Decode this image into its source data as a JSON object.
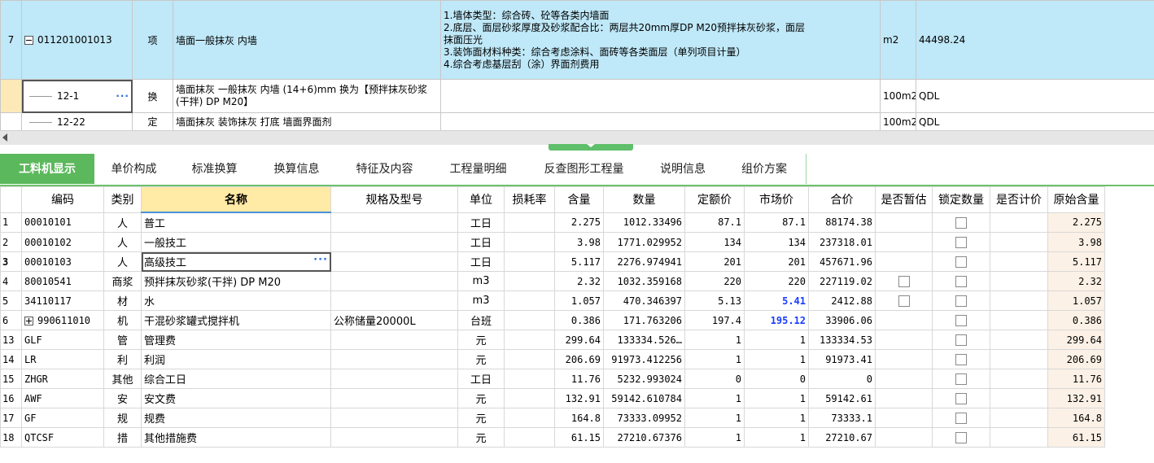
{
  "top": {
    "main": {
      "rownum": "7",
      "code": "011201001013",
      "type": "项",
      "name": "墙面一般抹灰 内墙",
      "features": [
        "1.墙体类型：综合砖、砼等各类内墙面",
        "2.底层、面层砂浆厚度及砂浆配合比：两层共20mm厚DP M20预拌抹灰砂浆，面层",
        "抹面压光",
        "3.装饰面材料种类：综合考虑涂料、面砖等各类面层（单列项目计量）",
        "4.综合考虑基层刮（涂）界面剂费用"
      ],
      "unit": "m2",
      "qty": "44498.24"
    },
    "subs": [
      {
        "code": "12-1",
        "type": "换",
        "name": "墙面抹灰 一般抹灰 内墙 (14+6)mm  换为【预拌抹灰砂浆(干拌) DP M20】",
        "unit": "100m2",
        "qty": "QDL"
      },
      {
        "code": "12-22",
        "type": "定",
        "name": "墙面抹灰 装饰抹灰 打底 墙面界面剂",
        "unit": "100m2",
        "qty": "QDL"
      }
    ]
  },
  "tabs": [
    "工料机显示",
    "单价构成",
    "标准换算",
    "换算信息",
    "特征及内容",
    "工程量明细",
    "反查图形工程量",
    "说明信息",
    "组价方案"
  ],
  "columns": [
    "编码",
    "类别",
    "名称",
    "规格及型号",
    "单位",
    "损耗率",
    "含量",
    "数量",
    "定额价",
    "市场价",
    "合价",
    "是否暂估",
    "锁定数量",
    "是否计价",
    "原始含量"
  ],
  "rows": [
    {
      "idx": "1",
      "code": "00010101",
      "cat": "人",
      "name": "普工",
      "spec": "",
      "unit": "工日",
      "loss": "",
      "content": "2.275",
      "qty": "1012.33496",
      "quota": "87.1",
      "market": "87.1",
      "total": "88174.38",
      "est": "",
      "lock": true,
      "orig": "2.275"
    },
    {
      "idx": "2",
      "code": "00010102",
      "cat": "人",
      "name": "一般技工",
      "spec": "",
      "unit": "工日",
      "loss": "",
      "content": "3.98",
      "qty": "1771.029952",
      "quota": "134",
      "market": "134",
      "total": "237318.01",
      "est": "",
      "lock": true,
      "orig": "3.98"
    },
    {
      "idx": "3",
      "code": "00010103",
      "cat": "人",
      "name": "高级技工",
      "spec": "",
      "unit": "工日",
      "loss": "",
      "content": "5.117",
      "qty": "2276.974941",
      "quota": "201",
      "market": "201",
      "total": "457671.96",
      "est": "",
      "lock": true,
      "orig": "5.117"
    },
    {
      "idx": "4",
      "code": "80010541",
      "cat": "商浆",
      "name": "预拌抹灰砂浆(干拌) DP M20",
      "spec": "",
      "unit": "m3",
      "loss": "",
      "content": "2.32",
      "qty": "1032.359168",
      "quota": "220",
      "market": "220",
      "total": "227119.02",
      "est": "box",
      "lock": true,
      "orig": "2.32"
    },
    {
      "idx": "5",
      "code": "34110117",
      "cat": "材",
      "name": "水",
      "spec": "",
      "unit": "m3",
      "loss": "",
      "content": "1.057",
      "qty": "470.346397",
      "quota": "5.13",
      "market": "5.41",
      "total": "2412.88",
      "est": "box",
      "lock": true,
      "orig": "1.057"
    },
    {
      "idx": "6",
      "code": "990611010",
      "cat": "机",
      "name": "干混砂浆罐式搅拌机",
      "spec": "公称储量20000L",
      "unit": "台班",
      "loss": "",
      "content": "0.386",
      "qty": "171.763206",
      "quota": "197.4",
      "market": "195.12",
      "total": "33906.06",
      "est": "",
      "lock": true,
      "orig": "0.386"
    },
    {
      "idx": "13",
      "code": "GLF",
      "cat": "管",
      "name": "管理费",
      "spec": "",
      "unit": "元",
      "loss": "",
      "content": "299.64",
      "qty": "133334.526…",
      "quota": "1",
      "market": "1",
      "total": "133334.53",
      "est": "",
      "lock": true,
      "orig": "299.64"
    },
    {
      "idx": "14",
      "code": "LR",
      "cat": "利",
      "name": "利润",
      "spec": "",
      "unit": "元",
      "loss": "",
      "content": "206.69",
      "qty": "91973.412256",
      "quota": "1",
      "market": "1",
      "total": "91973.41",
      "est": "",
      "lock": true,
      "orig": "206.69"
    },
    {
      "idx": "15",
      "code": "ZHGR",
      "cat": "其他",
      "name": "综合工日",
      "spec": "",
      "unit": "工日",
      "loss": "",
      "content": "11.76",
      "qty": "5232.993024",
      "quota": "0",
      "market": "0",
      "total": "0",
      "est": "",
      "lock": true,
      "orig": "11.76"
    },
    {
      "idx": "16",
      "code": "AWF",
      "cat": "安",
      "name": "安文费",
      "spec": "",
      "unit": "元",
      "loss": "",
      "content": "132.91",
      "qty": "59142.610784",
      "quota": "1",
      "market": "1",
      "total": "59142.61",
      "est": "",
      "lock": true,
      "orig": "132.91"
    },
    {
      "idx": "17",
      "code": "GF",
      "cat": "规",
      "name": "规费",
      "spec": "",
      "unit": "元",
      "loss": "",
      "content": "164.8",
      "qty": "73333.09952",
      "quota": "1",
      "market": "1",
      "total": "73333.1",
      "est": "",
      "lock": true,
      "orig": "164.8"
    },
    {
      "idx": "18",
      "code": "QTCSF",
      "cat": "措",
      "name": "其他措施费",
      "spec": "",
      "unit": "元",
      "loss": "",
      "content": "61.15",
      "qty": "27210.67376",
      "quota": "1",
      "market": "1",
      "total": "27210.67",
      "est": "",
      "lock": true,
      "orig": "61.15"
    }
  ],
  "highlight": {
    "current_row": "3",
    "blue_market_rows": [
      "5",
      "6"
    ],
    "expandable_row": "6"
  },
  "colors": {
    "active_tab": "#5cb85c",
    "main_row_bg": "#bfe8f8",
    "name_header_bg": "#ffeaa6",
    "changed_price": "#1a3bff"
  }
}
